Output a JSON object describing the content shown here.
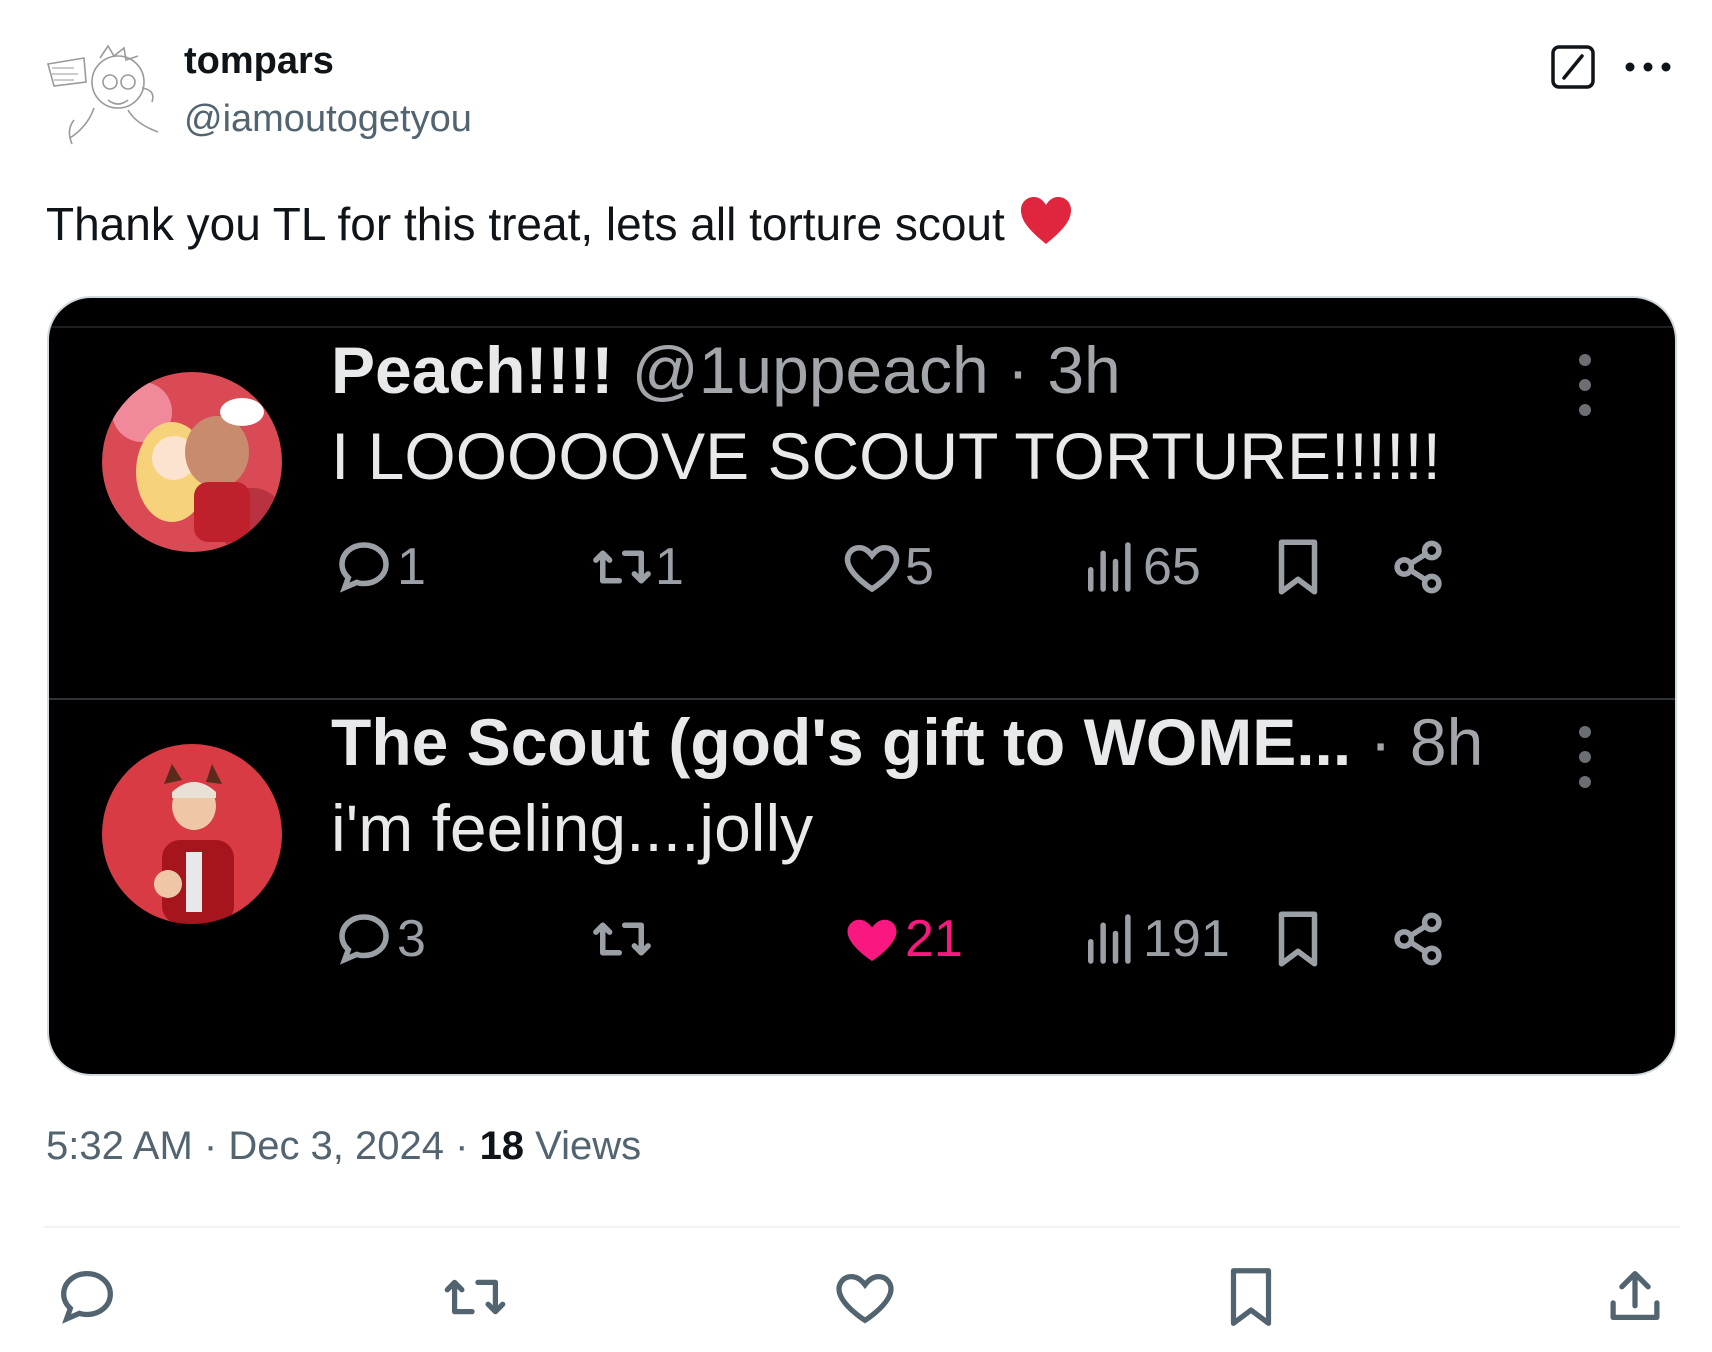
{
  "author": {
    "name": "tompars",
    "handle": "@iamoutogetyou"
  },
  "tweet": {
    "text": "Thank you TL for this treat, lets all torture scout"
  },
  "icons": {
    "heart_emoji": "red-heart-icon",
    "grok": "grok-icon",
    "more": "more-dots-icon"
  },
  "quoted_posts": [
    {
      "name": "Peach!!!!",
      "handle": "@1uppeach",
      "time": "· 3h",
      "text": "I LOOOOOVE SCOUT TORTURE!!!!!!",
      "replies": "1",
      "reposts": "1",
      "likes": "5",
      "views": "65"
    },
    {
      "name": "The Scout (god's gift to WOME...",
      "handle": "",
      "time": "· 8h",
      "text": "i'm feeling....jolly",
      "replies": "3",
      "reposts": "",
      "likes": "21",
      "views": "191"
    }
  ],
  "meta": {
    "time": "5:32 AM",
    "sep1": " · ",
    "date": "Dec 3, 2024",
    "sep2": " · ",
    "views_count": "18",
    "views_label": " Views"
  },
  "colors": {
    "liked_pink": "#f91880",
    "heart_red": "#e0263f",
    "card_bg": "#000000"
  }
}
